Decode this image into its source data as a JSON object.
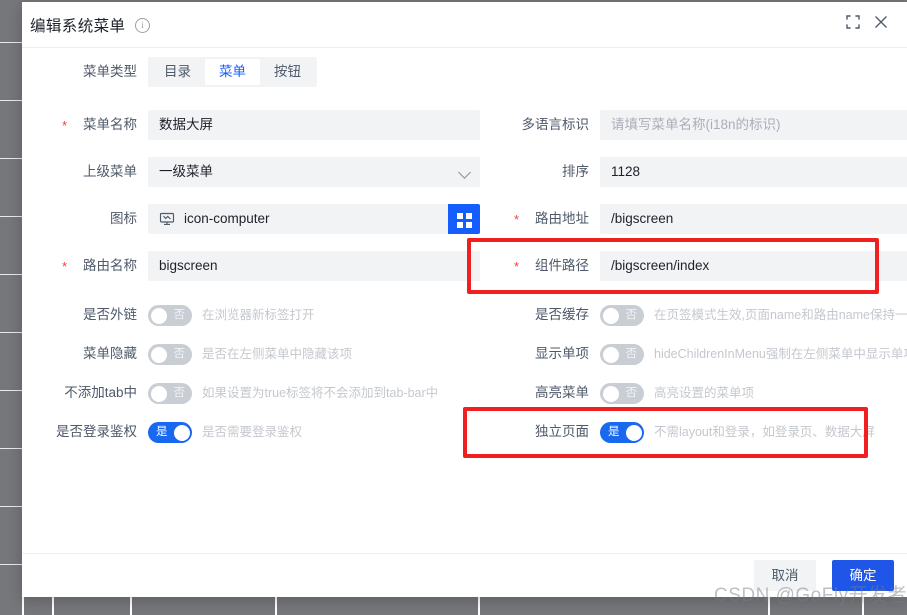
{
  "window": {
    "title": "编辑系统菜单",
    "info_icon": "info-circle-icon",
    "fullscreen_icon": "fullscreen-icon",
    "close_icon": "close-icon"
  },
  "menu_type": {
    "label": "菜单类型",
    "options": [
      "目录",
      "菜单",
      "按钮"
    ],
    "selected": "菜单"
  },
  "left_fields": [
    {
      "label": "菜单名称",
      "required": true,
      "value": "数据大屏",
      "type": "input"
    },
    {
      "label": "上级菜单",
      "required": false,
      "value": "一级菜单",
      "type": "select"
    },
    {
      "label": "图标",
      "required": false,
      "value": "icon-computer",
      "type": "icon",
      "icon_name": "computer-icon",
      "picker_icon": "grid-icon"
    },
    {
      "label": "路由名称",
      "required": true,
      "value": "bigscreen",
      "type": "input"
    }
  ],
  "right_fields": [
    {
      "label": "多语言标识",
      "required": false,
      "value": "",
      "placeholder": "请填写菜单名称(i18n的标识)",
      "type": "input"
    },
    {
      "label": "排序",
      "required": false,
      "value": "1128",
      "placeholder": "",
      "type": "input"
    },
    {
      "label": "路由地址",
      "required": true,
      "value": "/bigscreen",
      "placeholder": "",
      "type": "input"
    },
    {
      "label": "组件路径",
      "required": true,
      "value": "/bigscreen/index",
      "placeholder": "",
      "type": "input",
      "highlighted": true
    }
  ],
  "left_switches": [
    {
      "label": "是否外链",
      "state": "否",
      "on": false,
      "hint": "在浏览器新标签打开"
    },
    {
      "label": "菜单隐藏",
      "state": "否",
      "on": false,
      "hint": "是否在左侧菜单中隐藏该项"
    },
    {
      "label": "不添加tab中",
      "state": "否",
      "on": false,
      "hint": "如果设置为true标签将不会添加到tab-bar中"
    },
    {
      "label": "是否登录鉴权",
      "state": "是",
      "on": true,
      "hint": "是否需要登录鉴权"
    }
  ],
  "right_switches": [
    {
      "label": "是否缓存",
      "state": "否",
      "on": false,
      "hint": "在页签模式生效,页面name和路由name保持一致"
    },
    {
      "label": "显示单项",
      "state": "否",
      "on": false,
      "hint": "hideChildrenInMenu强制在左侧菜单中显示单项"
    },
    {
      "label": "高亮菜单",
      "state": "否",
      "on": false,
      "hint": "高亮设置的菜单项"
    },
    {
      "label": "独立页面",
      "state": "是",
      "on": true,
      "hint": "不需layout和登录，如登录页、数据大屏",
      "highlighted": true
    }
  ],
  "footer": {
    "cancel_label": "取消",
    "confirm_label": "确定"
  },
  "watermark": "CSDN @GoFly开发者",
  "colors": {
    "accent": "#165dff",
    "switch_on": "#1868f0",
    "switch_off": "#c9cdd4",
    "confirm_button": "#2056e8",
    "required_star": "#f53f3f",
    "highlight_box": "#f02020",
    "field_bg": "#f2f3f5",
    "backdrop": "#76777b"
  }
}
